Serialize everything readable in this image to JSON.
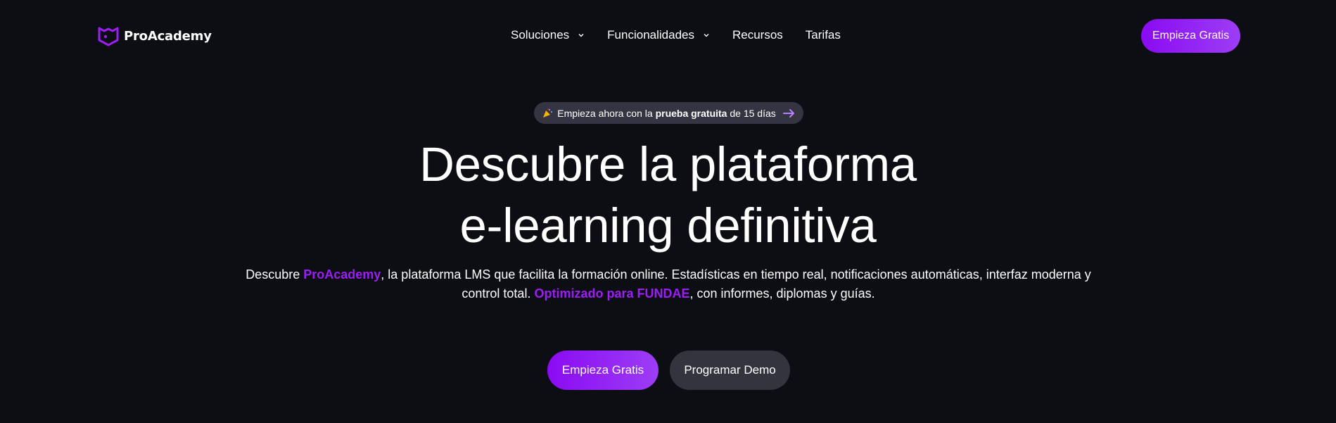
{
  "brand": {
    "name": "ProAcademy",
    "accent_color": "#9b1ef2",
    "logo_icon": "owl-shield-icon"
  },
  "nav": {
    "items": [
      {
        "label": "Soluciones",
        "has_dropdown": true
      },
      {
        "label": "Funcionalidades",
        "has_dropdown": true
      },
      {
        "label": "Recursos",
        "has_dropdown": false
      },
      {
        "label": "Tarifas",
        "has_dropdown": false
      }
    ],
    "cta_label": "Empieza Gratis"
  },
  "promo_pill": {
    "icon": "party-popper-icon",
    "text_before": "Empieza ahora con la",
    "text_bold": "prueba gratuita",
    "text_after": "de 15 días",
    "arrow_icon": "arrow-right-icon"
  },
  "hero": {
    "title_line1": "Descubre la plataforma",
    "title_line2": "e-learning definitiva",
    "sub_part1": "Descubre ",
    "sub_accent1": "ProAcademy",
    "sub_part2": ", la plataforma LMS que facilita la formación online. Estadísticas en tiempo real, notificaciones automáticas, interfaz moderna y control total. ",
    "sub_accent2": "Optimizado para FUNDAE",
    "sub_part3": ", con informes, diplomas y guías.",
    "primary_cta": "Empieza Gratis",
    "secondary_cta": "Programar Demo"
  },
  "colors": {
    "background": "#0d0d14",
    "pill_bg": "#343442",
    "secondary_btn_bg": "#34343f"
  }
}
